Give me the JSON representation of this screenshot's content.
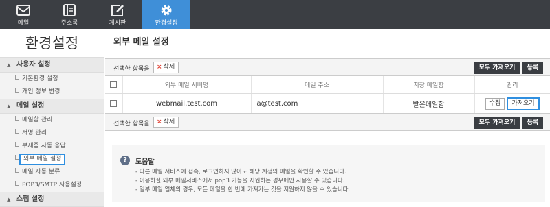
{
  "nav": [
    {
      "label": "메일",
      "icon": "mail-icon"
    },
    {
      "label": "주소록",
      "icon": "address-book-icon"
    },
    {
      "label": "게시판",
      "icon": "board-edit-icon"
    },
    {
      "label": "환경설정",
      "icon": "gear-icon"
    }
  ],
  "sidebar": {
    "title": "환경설정",
    "groups": [
      {
        "label": "사용자 설정",
        "items": [
          "기본환경 설정",
          "개인 정보 변경"
        ]
      },
      {
        "label": "메일 설정",
        "items": [
          "메일함 관리",
          "서명 관리",
          "부재중 자동 응답",
          "외부 메일 설정",
          "메일 자동 분류",
          "POP3/SMTP 사용설정"
        ]
      },
      {
        "label": "스팸 설정",
        "items": []
      }
    ]
  },
  "main": {
    "title": "외부 메일 설정",
    "select_label": "선택한 항목을",
    "delete_label": "삭제",
    "fetch_all_label": "모두 가져오기",
    "register_label": "등록",
    "table": {
      "headers": [
        "외부 메일 서버명",
        "메일 주소",
        "저장 메일함",
        "관리"
      ],
      "rows": [
        {
          "server": "webmail.test.com",
          "address": "a@test.com",
          "mailbox": "받은메일함",
          "edit": "수정",
          "fetch": "가져오기"
        }
      ]
    },
    "help": {
      "title": "도움말",
      "lines": [
        "- 다른 메일 서비스에 접속, 로그인하지 않아도 해당 계정의 메일을 확인할 수 있습니다.",
        "- 이용하실 외부 메일서비스에서 pop3 기능을 지원하는 경우에만 사용할 수 있습니다.",
        "- 일부 메일 업체의 경우, 모든 메일을 한 번에 가져가는 것을 지원하지 않을 수 있습니다."
      ]
    }
  },
  "colors": {
    "topbar": "#3b3e43",
    "active_tab": "#3f8fd8",
    "highlight": "#2f8fe0",
    "delete_x": "#e03b2d",
    "dark_button": "#3a3d42"
  }
}
